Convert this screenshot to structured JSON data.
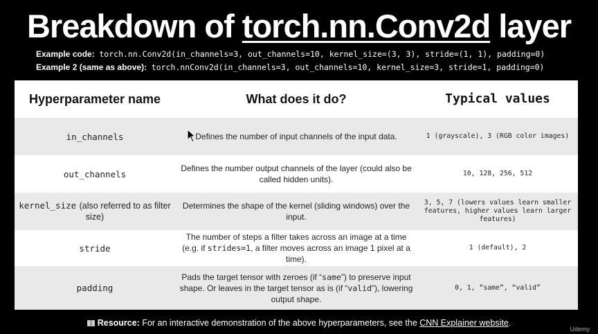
{
  "title": {
    "prefix": "Breakdown of ",
    "highlight": "torch.nn.Conv2d",
    "suffix": " layer"
  },
  "examples": [
    {
      "label": "Example code:",
      "code": "torch.nn.Conv2d(in_channels=3, out_channels=10, kernel_size=(3, 3), stride=(1, 1), padding=0)"
    },
    {
      "label": "Example 2 (same as above):",
      "code": "torch.nnConv2d(in_channels=3, out_channels=10, kernel_size=3, stride=1, padding=0)"
    }
  ],
  "table": {
    "headers": [
      "Hyperparameter name",
      "What does it do?",
      "Typical values"
    ],
    "rows": [
      {
        "name": "in_channels",
        "desc": "Defines the number of input channels of the input data.",
        "values": "1 (grayscale), 3 (RGB color images)"
      },
      {
        "name": "out_channels",
        "desc": "Defines the number output channels of the layer (could also be called hidden units).",
        "values": "10, 128, 256, 512"
      },
      {
        "name": "kernel_size",
        "name_note": "(also referred to as filter size)",
        "desc": "Determines the shape of the kernel (sliding windows) over the input.",
        "values": "3, 5, 7 (lowers values learn smaller features, higher values learn larger features)"
      },
      {
        "name": "stride",
        "desc_a": "The number of steps a filter takes across an image at a time (e.g. if ",
        "desc_code": "strides=1",
        "desc_b": ", a filter moves across an image 1 pixel at a time).",
        "values": "1 (default), 2"
      },
      {
        "name": "padding",
        "desc_a": "Pads the target tensor with zeroes (if “",
        "desc_code1": "same",
        "desc_b": "”) to preserve input shape. Or leaves in the target tensor as is (if “",
        "desc_code2": "valid",
        "desc_c": "”), lowering output shape.",
        "values": "0, 1, “same”, “valid”"
      }
    ]
  },
  "footer": {
    "label": "Resource:",
    "text": " For an interactive demonstration of the above hyperparameters, see the ",
    "link": "CNN Explainer website",
    "end": "."
  },
  "watermark": "Udemy",
  "icons": {
    "cursor": "mouse-pointer-icon",
    "resource": "book-icon"
  }
}
